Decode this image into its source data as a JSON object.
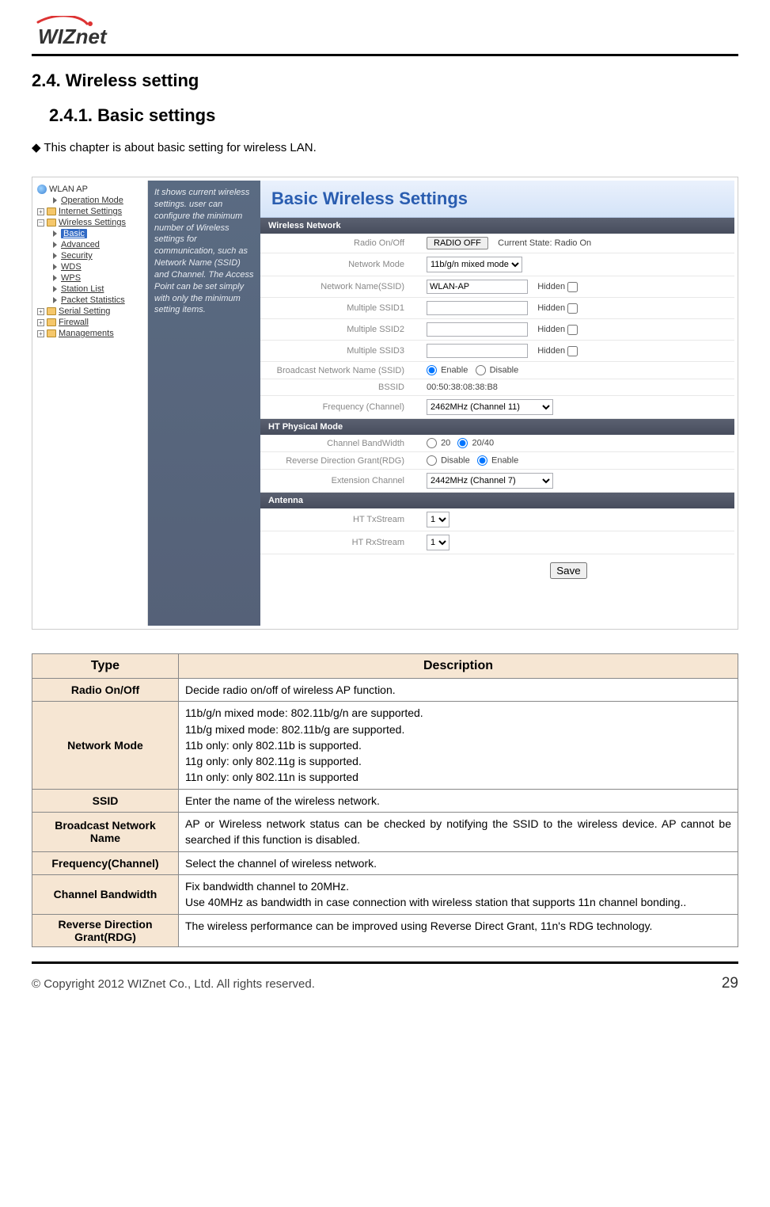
{
  "header": {
    "logo_text": "WIZnet"
  },
  "headings": {
    "h2": "2.4. Wireless setting",
    "h3": "2.4.1.  Basic  settings",
    "intro": "◆ This chapter is about basic setting for wireless LAN."
  },
  "screenshot": {
    "tree": {
      "root": "WLAN AP",
      "items": [
        "Operation Mode",
        "Internet Settings",
        "Wireless Settings",
        "Serial Setting",
        "Firewall",
        "Managements"
      ],
      "wireless_children": [
        "Basic",
        "Advanced",
        "Security",
        "WDS",
        "WPS",
        "Station List",
        "Packet Statistics"
      ]
    },
    "help_text": "It shows current wireless settings. user can configure the minimum number of Wireless settings for communication, such as Network Name (SSID) and Channel. The Access Point can be set simply with only the minimum setting items.",
    "main_title": "Basic Wireless Settings",
    "sections": {
      "wireless_network": "Wireless Network",
      "ht_physical_mode": "HT Physical Mode",
      "antenna": "Antenna"
    },
    "form": {
      "radio_onoff_label": "Radio On/Off",
      "radio_onoff_button": "RADIO OFF",
      "radio_state": "Current State: Radio On",
      "network_mode_label": "Network Mode",
      "network_mode_value": "11b/g/n mixed mode",
      "ssid_label": "Network Name(SSID)",
      "ssid_value": "WLAN-AP",
      "hidden_label": "Hidden",
      "mssid1_label": "Multiple SSID1",
      "mssid2_label": "Multiple SSID2",
      "mssid3_label": "Multiple SSID3",
      "broadcast_label": "Broadcast Network Name (SSID)",
      "enable_label": "Enable",
      "disable_label": "Disable",
      "bssid_label": "BSSID",
      "bssid_value": "00:50:38:08:38:B8",
      "freq_label": "Frequency (Channel)",
      "freq_value": "2462MHz (Channel 11)",
      "chbw_label": "Channel BandWidth",
      "chbw_20": "20",
      "chbw_2040": "20/40",
      "rdg_label": "Reverse Direction Grant(RDG)",
      "ext_channel_label": "Extension Channel",
      "ext_channel_value": "2442MHz (Channel 7)",
      "httx_label": "HT TxStream",
      "httx_value": "1",
      "htrx_label": "HT RxStream",
      "htrx_value": "1",
      "save_button": "Save"
    }
  },
  "desc_table": {
    "head_type": "Type",
    "head_desc": "Description",
    "rows": [
      {
        "type": "Radio On/Off",
        "desc": "Decide radio on/off of wireless AP function."
      },
      {
        "type": "Network Mode",
        "desc": "11b/g/n mixed mode: 802.11b/g/n are supported.\n11b/g mixed mode: 802.11b/g are supported.\n11b only: only 802.11b is supported.\n11g only: only 802.11g is supported.\n11n only: only 802.11n is supported"
      },
      {
        "type": "SSID",
        "desc": "Enter the name of the wireless network."
      },
      {
        "type": "Broadcast Network Name",
        "desc": "AP or Wireless network status can be checked by notifying the SSID to the wireless device. AP cannot be searched if this function is disabled."
      },
      {
        "type": "Frequency(Channel)",
        "desc": "Select the channel of wireless network."
      },
      {
        "type": "Channel Bandwidth",
        "desc": "Fix bandwidth channel to 20MHz.\nUse 40MHz as bandwidth in case connection with wireless station that supports 11n channel bonding.."
      },
      {
        "type": "Reverse Direction Grant(RDG)",
        "desc": "The wireless performance can be improved using Reverse Direct Grant, 11n's RDG technology."
      }
    ]
  },
  "footer": {
    "copyright": "© Copyright 2012 WIZnet Co., Ltd. All rights reserved.",
    "page": "29"
  }
}
